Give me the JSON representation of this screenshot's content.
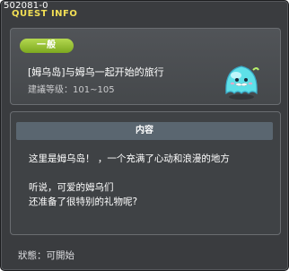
{
  "window": {
    "id_label": "502081-0",
    "title": "QUEST INFO"
  },
  "quest": {
    "category": "一般",
    "name": "[姆乌岛]与姆乌一起开始的旅行",
    "level_label": "建議等级：101~105",
    "mascot_icon": "slime-mascot-icon"
  },
  "content": {
    "header": "内容",
    "lines_1": [
      "这里是姆乌岛！ ，一个充满了心动和浪漫的地方"
    ],
    "lines_2": [
      "听说，可爱的姆乌们",
      "还准备了很特别的礼物呢?"
    ]
  },
  "status": {
    "text": "狀態：可開始"
  },
  "colors": {
    "title": "#f2df55",
    "category_badge": "#8dbb2b",
    "panel_header": "#5a6670"
  }
}
